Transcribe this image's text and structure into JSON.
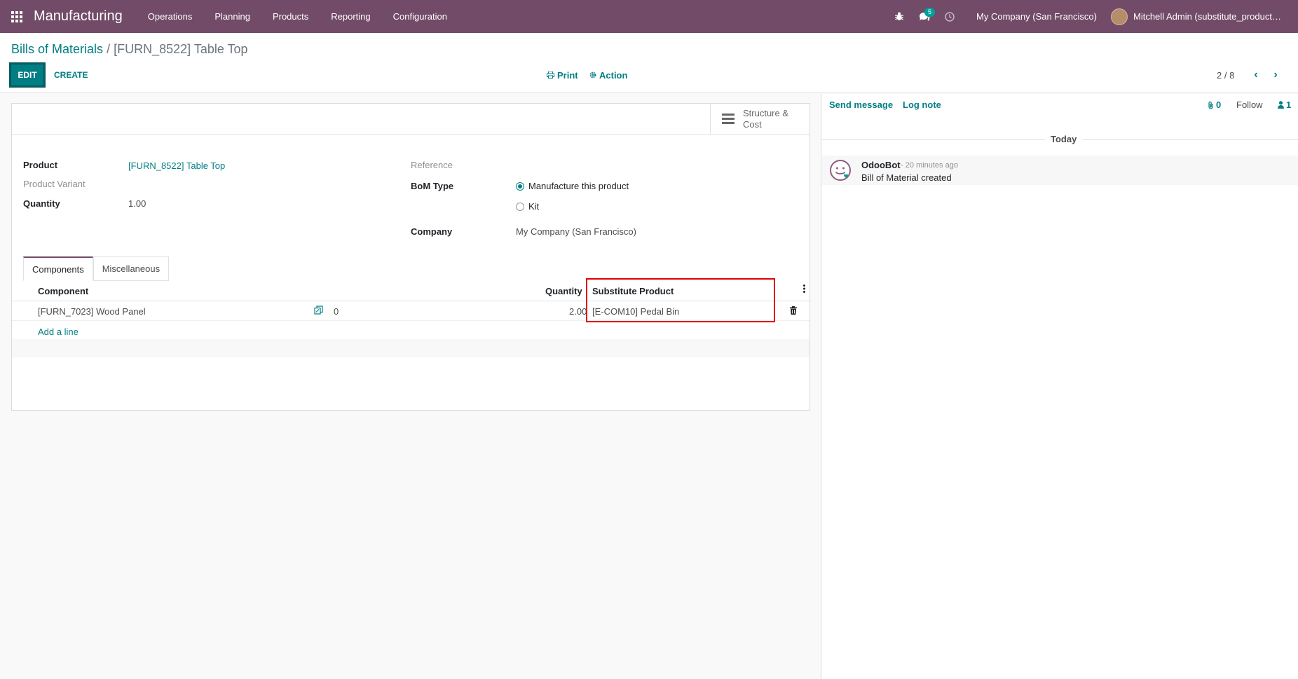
{
  "navbar": {
    "brand": "Manufacturing",
    "menu": [
      "Operations",
      "Planning",
      "Products",
      "Reporting",
      "Configuration"
    ],
    "messages_badge": "5",
    "company": "My Company (San Francisco)",
    "user": "Mitchell Admin (substitute_product_in_…"
  },
  "control_panel": {
    "breadcrumb_parent": "Bills of Materials",
    "breadcrumb_sep": "/",
    "breadcrumb_current": "[FURN_8522] Table Top",
    "edit_label": "EDIT",
    "create_label": "CREATE",
    "print_label": "Print",
    "action_label": "Action",
    "pager": "2 / 8"
  },
  "form": {
    "stat_button_label": "Structure & Cost",
    "product_label": "Product",
    "product_value": "[FURN_8522] Table Top",
    "variant_label": "Product Variant",
    "quantity_label": "Quantity",
    "quantity_value": "1.00",
    "reference_label": "Reference",
    "bom_type_label": "BoM Type",
    "bom_type_options": [
      "Manufacture this product",
      "Kit"
    ],
    "bom_type_selected": "Manufacture this product",
    "company_label": "Company",
    "company_value": "My Company (San Francisco)",
    "tabs": [
      "Components",
      "Miscellaneous"
    ],
    "active_tab": "Components",
    "columns": {
      "component": "Component",
      "quantity": "Quantity",
      "substitute": "Substitute Product"
    },
    "rows": [
      {
        "component": "[FURN_7023] Wood Panel",
        "forecast": "0",
        "quantity": "2.00",
        "substitute": "[E-COM10] Pedal Bin"
      }
    ],
    "add_line": "Add a line"
  },
  "chatter": {
    "send_message": "Send message",
    "log_note": "Log note",
    "attachments_count": "0",
    "follow": "Follow",
    "followers_count": "1",
    "separator": "Today",
    "messages": [
      {
        "author": "OdooBot",
        "time": "- 20 minutes ago",
        "body": "Bill of Material created"
      }
    ]
  },
  "colors": {
    "navbar": "#714b67",
    "primary": "#017e84",
    "highlight": "#e00000"
  }
}
